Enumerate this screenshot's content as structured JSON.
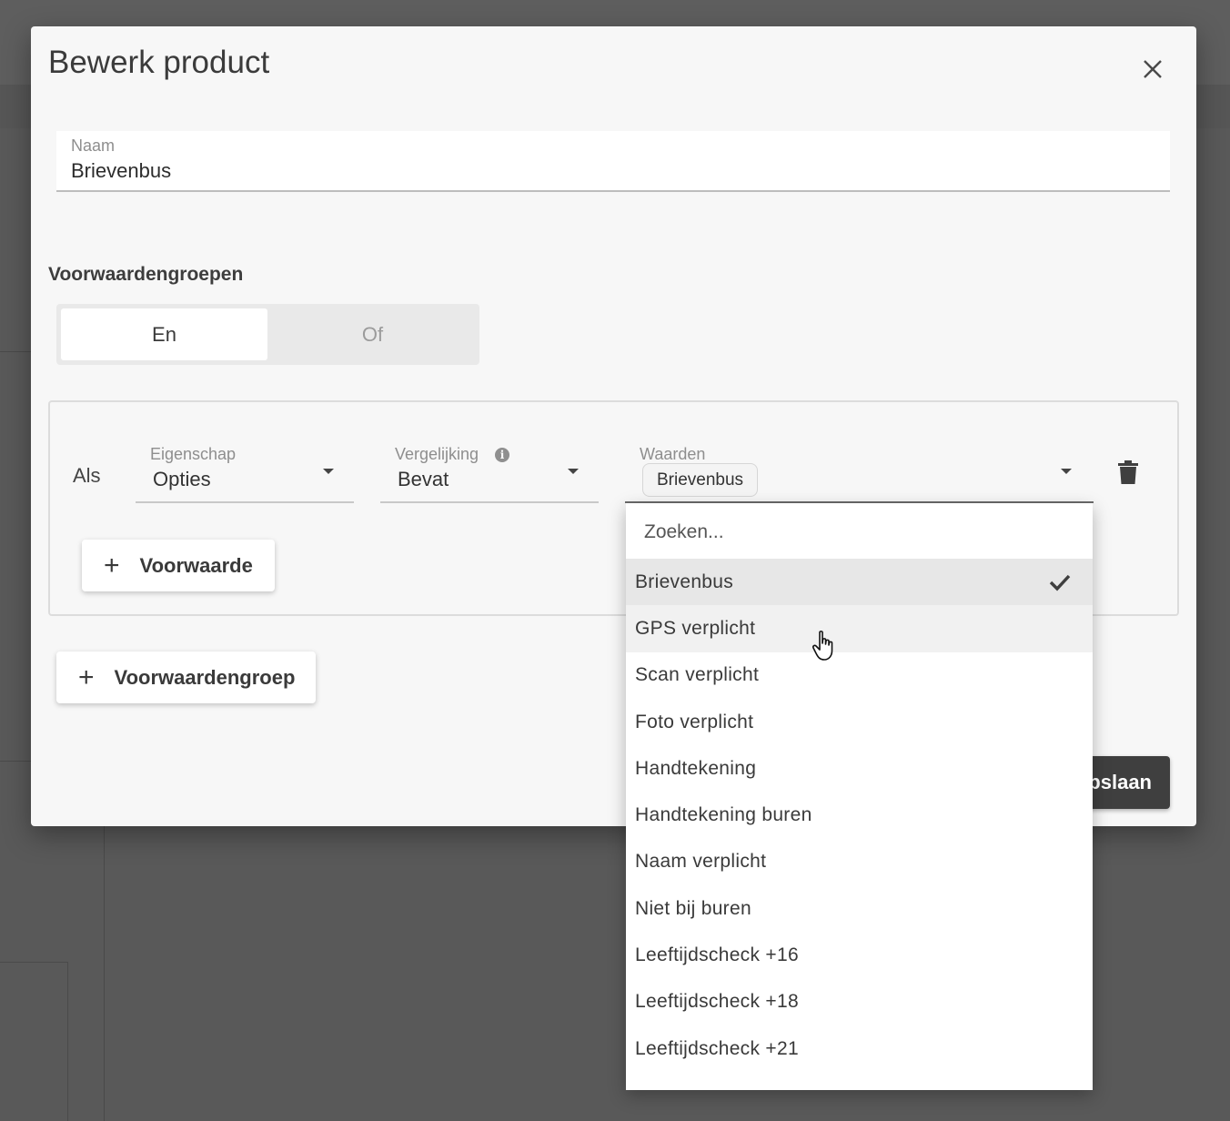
{
  "dialog": {
    "title": "Bewerk product",
    "close_icon": "close-icon"
  },
  "name_field": {
    "label": "Naam",
    "value": "Brievenbus"
  },
  "conditions": {
    "section_title": "Voorwaardengroepen",
    "toggle": {
      "options": [
        "En",
        "Of"
      ],
      "selected": "En"
    },
    "group": {
      "prefix": "Als",
      "property": {
        "label": "Eigenschap",
        "value": "Opties"
      },
      "comparison": {
        "label": "Vergelijking",
        "value": "Bevat",
        "info_icon": "info-icon"
      },
      "values": {
        "label": "Waarden",
        "chips": [
          "Brievenbus"
        ]
      },
      "delete_icon": "trash-icon",
      "add_condition_label": "Voorwaarde"
    },
    "add_group_label": "Voorwaardengroep"
  },
  "save_button_label": "opslaan",
  "dropdown": {
    "search_placeholder": "Zoeken...",
    "items": [
      "Brievenbus",
      "GPS verplicht",
      "Scan verplicht",
      "Foto verplicht",
      "Handtekening",
      "Handtekening buren",
      "Naam verplicht",
      "Niet bij buren",
      "Leeftijdscheck +16",
      "Leeftijdscheck +18",
      "Leeftijdscheck +21"
    ],
    "selected_item": "Brievenbus",
    "hovered_item": "GPS verplicht"
  }
}
